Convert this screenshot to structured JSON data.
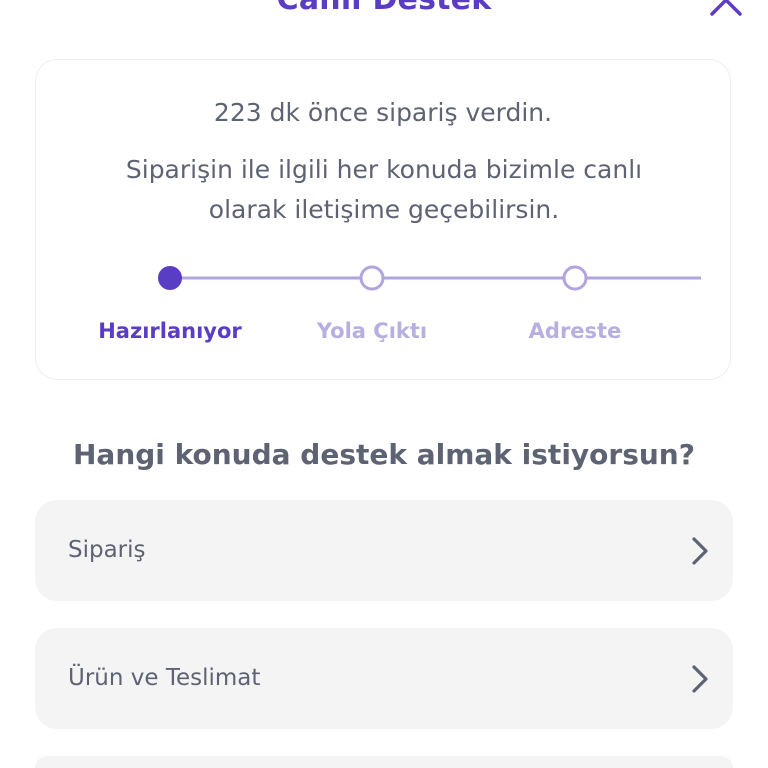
{
  "header": {
    "title": "Canlı Destek",
    "close_icon": "close-icon"
  },
  "status_card": {
    "time_text": "223 dk önce sipariş verdin.",
    "description": "Siparişin ile ilgili her konuda bizimle canlı olarak iletişime geçebilirsin.",
    "steps": [
      {
        "label": "Hazırlanıyor",
        "state": "active"
      },
      {
        "label": "Yola Çıktı",
        "state": "inactive"
      },
      {
        "label": "Adreste",
        "state": "inactive"
      }
    ]
  },
  "question": "Hangi konuda destek almak istiyorsun?",
  "topics": [
    {
      "label": "Sipariş",
      "icon": "chevron-right-icon"
    },
    {
      "label": "Ürün ve Teslimat",
      "icon": "chevron-right-icon"
    },
    {
      "label": "",
      "icon": ""
    }
  ],
  "colors": {
    "accent": "#5b3cc4",
    "accent_light": "#b3a5dc",
    "text": "#5e6373",
    "item_bg": "#f4f4f5"
  }
}
